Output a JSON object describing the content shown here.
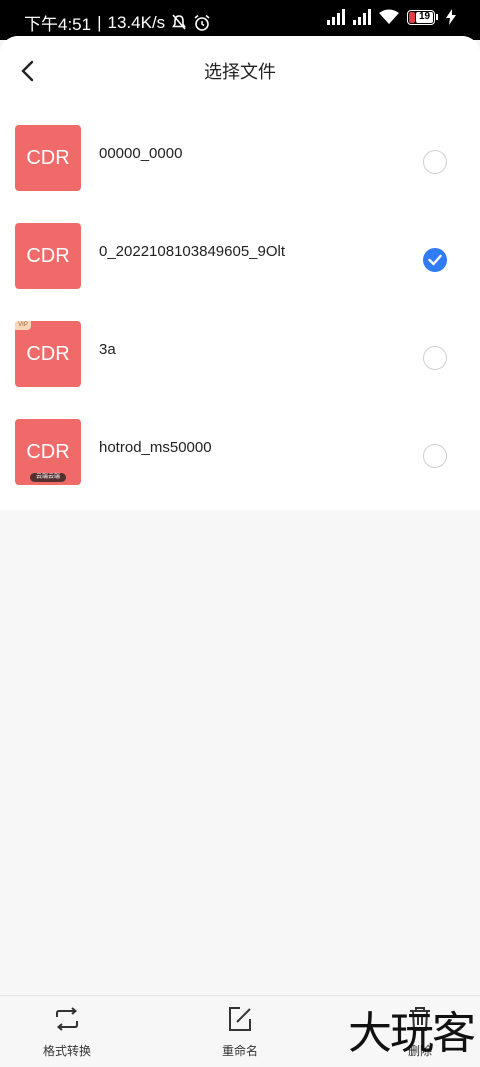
{
  "status_bar": {
    "time": "下午4:51",
    "separator": "|",
    "net_speed": "13.4K/s",
    "battery": "19"
  },
  "header": {
    "title": "选择文件"
  },
  "files": [
    {
      "thumb_label": "CDR",
      "name": "00000_0000",
      "checked": false
    },
    {
      "thumb_label": "CDR",
      "name": "0_2022108103849605_9Olt",
      "checked": true
    },
    {
      "thumb_label": "CDR",
      "name": "3a",
      "checked": false,
      "badge_vip": "VIP"
    },
    {
      "thumb_label": "CDR",
      "name": "hotrod_ms50000",
      "checked": false,
      "badge_cloud": "云端云端"
    }
  ],
  "toolbar": {
    "convert_label": "格式转换",
    "rename_label": "重命名",
    "delete_label": "删除"
  },
  "watermark": "大玩客",
  "colors": {
    "thumb": "#f06a6a",
    "accent": "#2f7cf6",
    "status_bg": "#000000"
  }
}
